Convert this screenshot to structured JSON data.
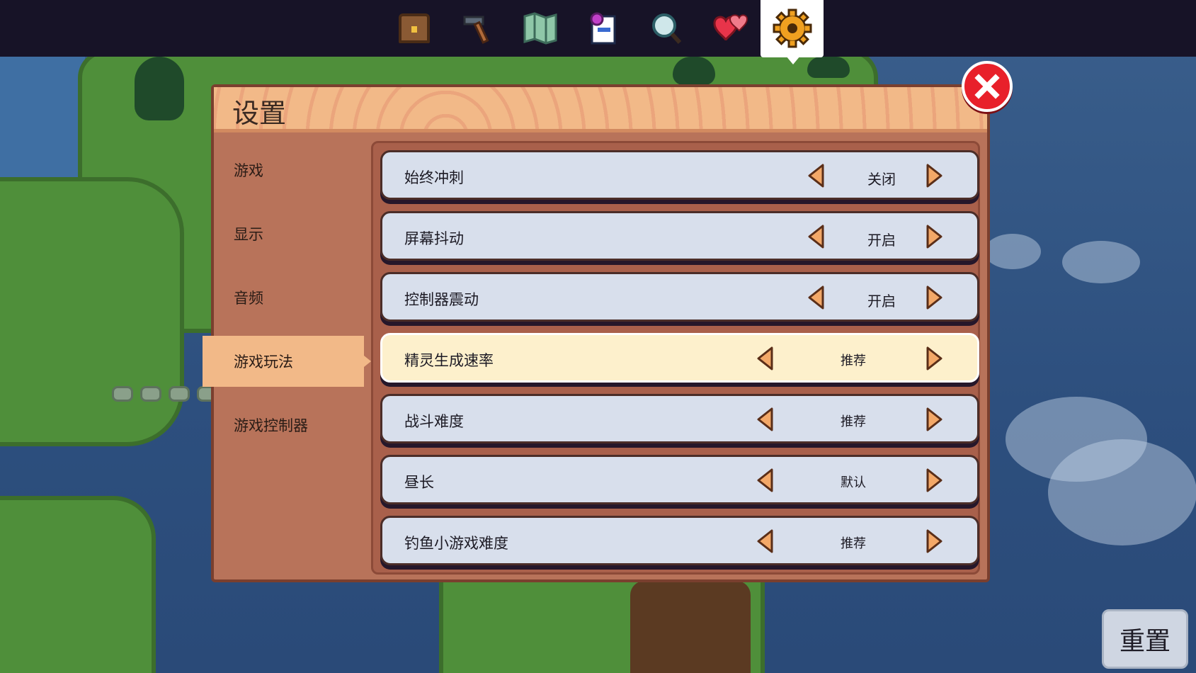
{
  "menu": {
    "tabs": [
      {
        "icon": "chest-icon"
      },
      {
        "icon": "hammer-icon"
      },
      {
        "icon": "map-icon"
      },
      {
        "icon": "quest-scroll-icon"
      },
      {
        "icon": "magnifier-icon"
      },
      {
        "icon": "heart-icon"
      },
      {
        "icon": "gear-icon",
        "active": true
      }
    ]
  },
  "settings": {
    "title": "设置",
    "sidebar": [
      {
        "label": "游戏"
      },
      {
        "label": "显示"
      },
      {
        "label": "音频"
      },
      {
        "label": "游戏玩法",
        "active": true
      },
      {
        "label": "游戏控制器"
      }
    ],
    "options": [
      {
        "label": "始终冲刺",
        "value": "关闭"
      },
      {
        "label": "屏幕抖动",
        "value": "开启"
      },
      {
        "label": "控制器震动",
        "value": "开启"
      },
      {
        "label": "精灵生成速率",
        "value": "推荐",
        "selected": true
      },
      {
        "label": "战斗难度",
        "value": "推荐"
      },
      {
        "label": "昼长",
        "value": "默认"
      },
      {
        "label": "钓鱼小游戏难度",
        "value": "推荐"
      }
    ],
    "reset_label": "重置"
  },
  "colors": {
    "accent": "#f2b988",
    "arrow_fill": "#f3a868",
    "close": "#e8202a"
  }
}
